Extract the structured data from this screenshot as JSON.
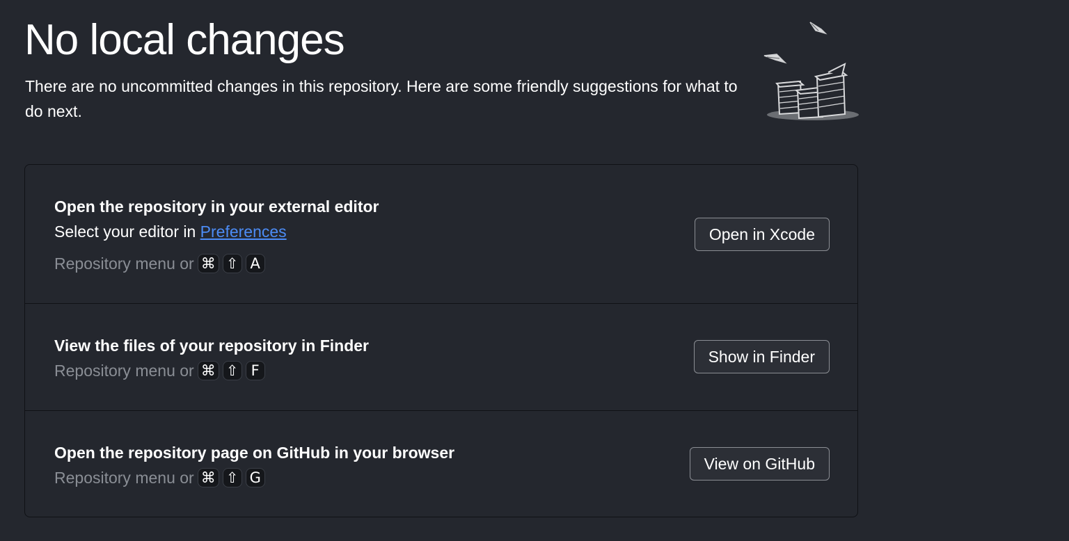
{
  "header": {
    "title": "No local changes",
    "subtitle": "There are no uncommitted changes in this repository. Here are some friendly suggestions for what to do next."
  },
  "suggestions": [
    {
      "title": "Open the repository in your external editor",
      "description_prefix": "Select your editor in ",
      "description_link": "Preferences",
      "shortcut_prefix": "Repository menu or",
      "keys": [
        "⌘",
        "⇧",
        "A"
      ],
      "button_label": "Open in Xcode"
    },
    {
      "title": "View the files of your repository in Finder",
      "shortcut_prefix": "Repository menu or",
      "keys": [
        "⌘",
        "⇧",
        "F"
      ],
      "button_label": "Show in Finder"
    },
    {
      "title": "Open the repository page on GitHub in your browser",
      "shortcut_prefix": "Repository menu or",
      "keys": [
        "⌘",
        "⇧",
        "G"
      ],
      "button_label": "View on GitHub"
    }
  ],
  "colors": {
    "background": "#24272e",
    "link": "#4c8cf5",
    "muted_text": "#8a8e95"
  },
  "icons": {
    "illustration": "paper-stacks-illustration-icon"
  }
}
